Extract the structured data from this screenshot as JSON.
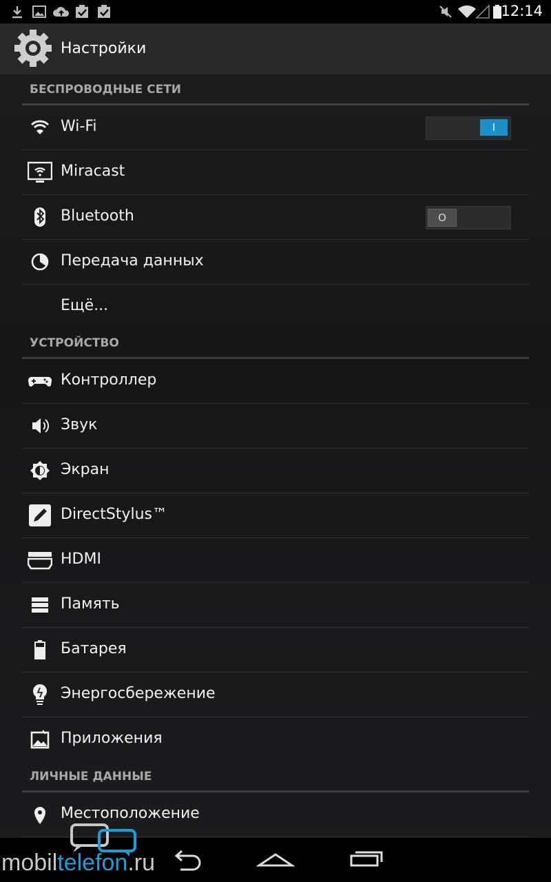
{
  "status_bar": {
    "time": "12:14",
    "left_icons": [
      "download-icon",
      "image-icon",
      "cloud-upload-icon",
      "checkbox-icon",
      "checkbox-icon"
    ],
    "right_icons": [
      "mute-icon",
      "wifi-icon",
      "signal-icon",
      "battery-icon"
    ]
  },
  "action_bar": {
    "title": "Настройки",
    "icon": "settings-gear-icon"
  },
  "sections": {
    "wireless": "БЕСПРОВОДНЫЕ СЕТИ",
    "device": "УСТРОЙСТВО",
    "personal": "ЛИЧНЫЕ ДАННЫЕ"
  },
  "items": {
    "wifi": {
      "label": "Wi-Fi",
      "toggle": "I",
      "toggle_state": "on"
    },
    "miracast": {
      "label": "Miracast"
    },
    "bluetooth": {
      "label": "Bluetooth",
      "toggle": "O",
      "toggle_state": "off"
    },
    "data": {
      "label": "Передача данных"
    },
    "more": {
      "label": "Ещё..."
    },
    "controller": {
      "label": "Контроллер"
    },
    "sound": {
      "label": "Звук"
    },
    "display": {
      "label": "Экран"
    },
    "stylus": {
      "label": "DirectStylus™"
    },
    "hdmi": {
      "label": "HDMI"
    },
    "storage": {
      "label": "Память"
    },
    "battery": {
      "label": "Батарея"
    },
    "power": {
      "label": "Энергосбережение"
    },
    "apps": {
      "label": "Приложения"
    },
    "location": {
      "label": "Местоположение"
    }
  },
  "watermark": {
    "part1": "mobil",
    "part2": "telefon",
    "part3": ".ru"
  },
  "colors": {
    "accent": "#1b91c8",
    "background": "#141618",
    "section_text": "#a8a8a8"
  }
}
